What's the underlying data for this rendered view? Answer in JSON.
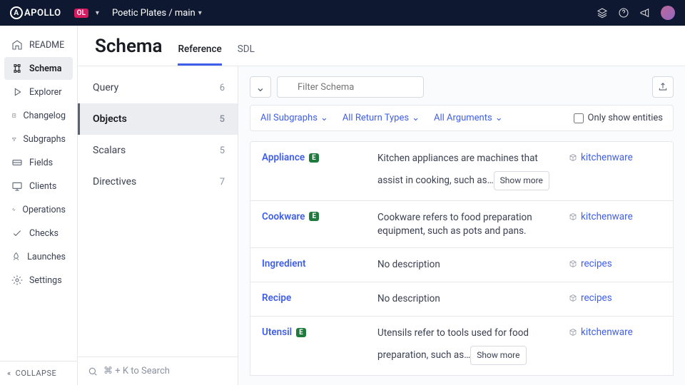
{
  "top": {
    "brand": "APOLLO",
    "org_badge": "OL",
    "graph_label": "Poetic Plates / main"
  },
  "rail": {
    "items": [
      {
        "icon": "readme",
        "label": "README"
      },
      {
        "icon": "schema",
        "label": "Schema"
      },
      {
        "icon": "explorer",
        "label": "Explorer"
      },
      {
        "icon": "changelog",
        "label": "Changelog"
      },
      {
        "icon": "subgraphs",
        "label": "Subgraphs"
      },
      {
        "icon": "fields",
        "label": "Fields"
      },
      {
        "icon": "clients",
        "label": "Clients"
      },
      {
        "icon": "operations",
        "label": "Operations"
      },
      {
        "icon": "checks",
        "label": "Checks"
      },
      {
        "icon": "launches",
        "label": "Launches"
      },
      {
        "icon": "settings",
        "label": "Settings"
      }
    ],
    "active_index": 1,
    "collapse": "COLLAPSE"
  },
  "header": {
    "title": "Schema",
    "tabs": [
      "Reference",
      "SDL"
    ],
    "active_tab": 0
  },
  "mid_nav": {
    "items": [
      {
        "label": "Query",
        "count": "6"
      },
      {
        "label": "Objects",
        "count": "5"
      },
      {
        "label": "Scalars",
        "count": "5"
      },
      {
        "label": "Directives",
        "count": "7"
      }
    ],
    "active_index": 1,
    "search_hint": "⌘ + K to Search"
  },
  "toolbar": {
    "filter_placeholder": "Filter Schema"
  },
  "filter_bar": {
    "subgraphs": "All Subgraphs",
    "return_types": "All Return Types",
    "arguments": "All Arguments",
    "only_entities": "Only show entities"
  },
  "objects": [
    {
      "name": "Appliance",
      "entity": true,
      "desc": "Kitchen appliances are machines that assist in cooking, such as…",
      "show_more": true,
      "subgraph": "kitchenware"
    },
    {
      "name": "Cookware",
      "entity": true,
      "desc": "Cookware refers to food preparation equipment, such as pots and pans.",
      "show_more": false,
      "subgraph": "kitchenware"
    },
    {
      "name": "Ingredient",
      "entity": false,
      "desc": "No description",
      "show_more": false,
      "subgraph": "recipes"
    },
    {
      "name": "Recipe",
      "entity": false,
      "desc": "No description",
      "show_more": false,
      "subgraph": "recipes"
    },
    {
      "name": "Utensil",
      "entity": true,
      "desc": "Utensils refer to tools used for food preparation, such as…",
      "show_more": true,
      "subgraph": "kitchenware"
    }
  ],
  "show_more_label": "Show more"
}
